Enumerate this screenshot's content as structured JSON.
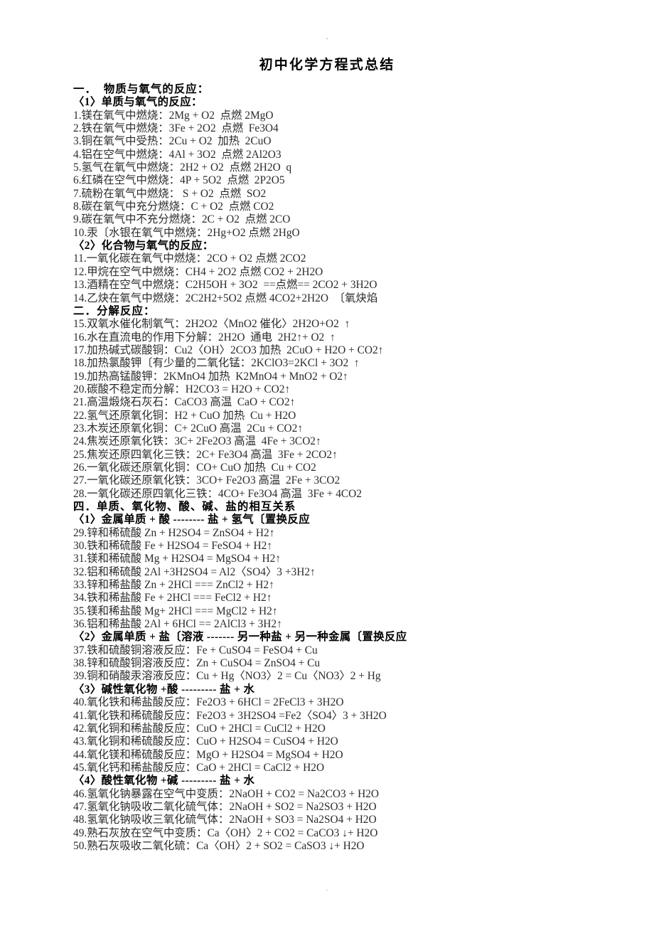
{
  "document": {
    "title": "初中化学方程式总结",
    "header_mark": "·",
    "footer_mark": "·"
  },
  "lines": [
    {
      "kind": "heading-major",
      "text": "一．  物质与氧气的反应："
    },
    {
      "kind": "heading",
      "text": "〈1〉单质与氧气的反应："
    },
    {
      "kind": "body",
      "text": "1.镁在氧气中燃烧：2Mg + O2  点燃 2MgO"
    },
    {
      "kind": "body",
      "text": "2.铁在氧气中燃烧：3Fe + 2O2  点燃  Fe3O4"
    },
    {
      "kind": "body",
      "text": "3.铜在氧气中受热：2Cu + O2  加热  2CuO"
    },
    {
      "kind": "body",
      "text": "4.铝在空气中燃烧：4Al + 3O2  点燃 2Al2O3"
    },
    {
      "kind": "body",
      "text": "5.氢气在氧气中燃烧：2H2 + O2  点燃 2H2O  q"
    },
    {
      "kind": "body",
      "text": "6.红磷在空气中燃烧：4P + 5O2  点燃  2P2O5"
    },
    {
      "kind": "body",
      "text": "7.硫粉在氧气中燃烧： S + O2  点燃  SO2"
    },
    {
      "kind": "body",
      "text": "8.碳在氧气中充分燃烧：C + O2  点燃 CO2"
    },
    {
      "kind": "body",
      "text": "9.碳在氧气中不充分燃烧：2C + O2  点燃 2CO"
    },
    {
      "kind": "body",
      "text": "10.汞〔水银在氧气中燃烧：2Hg+O2 点燃 2HgO"
    },
    {
      "kind": "heading",
      "text": "〈2〉化合物与氧气的反应："
    },
    {
      "kind": "body",
      "text": "11.一氧化碳在氧气中燃烧：2CO + O2 点燃 2CO2"
    },
    {
      "kind": "body",
      "text": "12.甲烷在空气中燃烧：CH4 + 2O2 点燃 CO2 + 2H2O"
    },
    {
      "kind": "body",
      "text": "13.酒精在空气中燃烧：C2H5OH + 3O2  ==点燃== 2CO2 + 3H2O"
    },
    {
      "kind": "body",
      "text": "14.乙炔在氧气中燃烧：2C2H2+5O2 点燃 4CO2+2H2O  〔氧炔焰"
    },
    {
      "kind": "heading-major",
      "text": "二．分解反应："
    },
    {
      "kind": "body",
      "text": "15.双氧水催化制氧气：2H2O2〈MnO2 催化〉2H2O+O2  ↑"
    },
    {
      "kind": "body",
      "text": "16.水在直流电的作用下分解：2H2O  通电  2H2↑+ O2  ↑"
    },
    {
      "kind": "body",
      "text": "17.加热碱式碳酸铜：Cu2〈OH〉2CO3 加热  2CuO + H2O + CO2↑"
    },
    {
      "kind": "body",
      "text": "18.加热氯酸钾〔有少量的二氧化锰：2KClO3=2KCl + 3O2  ↑"
    },
    {
      "kind": "body",
      "text": "19.加热高锰酸钾：2KMnO4 加热  K2MnO4 + MnO2 + O2↑"
    },
    {
      "kind": "body",
      "text": "20.碳酸不稳定而分解：H2CO3 = H2O + CO2↑"
    },
    {
      "kind": "body",
      "text": "21.高温煅烧石灰石：CaCO3 高温  CaO + CO2↑"
    },
    {
      "kind": "body",
      "text": "22.氢气还原氧化铜：H2 + CuO 加热  Cu + H2O"
    },
    {
      "kind": "body",
      "text": "23.木炭还原氧化铜：C+ 2CuO 高温  2Cu + CO2↑"
    },
    {
      "kind": "body",
      "text": "24.焦炭还原氧化铁：3C+ 2Fe2O3 高温  4Fe + 3CO2↑"
    },
    {
      "kind": "body",
      "text": "25.焦炭还原四氧化三铁：2C+ Fe3O4 高温  3Fe + 2CO2↑"
    },
    {
      "kind": "body",
      "text": "26.一氧化碳还原氧化铜：CO+ CuO 加热  Cu + CO2"
    },
    {
      "kind": "body",
      "text": "27.一氧化碳还原氧化铁：3CO+ Fe2O3 高温  2Fe + 3CO2"
    },
    {
      "kind": "body",
      "text": "28.一氧化碳还原四氧化三铁：4CO+ Fe3O4 高温  3Fe + 4CO2"
    },
    {
      "kind": "heading-major",
      "text": "四．单质、氧化物、酸、碱、盐的相互关系"
    },
    {
      "kind": "heading",
      "text": "〈1〉金属单质 + 酸 -------- 盐 + 氢气〔置换反应"
    },
    {
      "kind": "body",
      "text": "29.锌和稀硫酸 Zn + H2SO4 = ZnSO4 + H2↑"
    },
    {
      "kind": "body",
      "text": "30.铁和稀硫酸 Fe + H2SO4 = FeSO4 + H2↑"
    },
    {
      "kind": "body",
      "text": "31.镁和稀硫酸 Mg + H2SO4 = MgSO4 + H2↑"
    },
    {
      "kind": "body",
      "text": "32.铝和稀硫酸 2Al +3H2SO4 = Al2〈SO4〉3 +3H2↑"
    },
    {
      "kind": "body",
      "text": "33.锌和稀盐酸 Zn + 2HCl === ZnCl2 + H2↑"
    },
    {
      "kind": "body",
      "text": "34.铁和稀盐酸 Fe + 2HCl === FeCl2 + H2↑"
    },
    {
      "kind": "body",
      "text": "35.镁和稀盐酸 Mg+ 2HCl === MgCl2 + H2↑"
    },
    {
      "kind": "body",
      "text": "36.铝和稀盐酸 2Al + 6HCl == 2AlCl3 + 3H2↑"
    },
    {
      "kind": "heading",
      "text": "〈2〉金属单质 + 盐〔溶液 ------- 另一种盐 + 另一种金属〔置换反应"
    },
    {
      "kind": "body",
      "text": "37.铁和硫酸铜溶液反应：Fe + CuSO4 = FeSO4 + Cu"
    },
    {
      "kind": "body",
      "text": "38.锌和硫酸铜溶液反应：Zn + CuSO4 = ZnSO4 + Cu"
    },
    {
      "kind": "body",
      "text": "39.铜和硝酸汞溶液反应：Cu + Hg〈NO3〉2 = Cu〈NO3〉2 + Hg"
    },
    {
      "kind": "heading",
      "text": "〈3〉碱性氧化物 +酸 --------- 盐 + 水"
    },
    {
      "kind": "body",
      "text": "40.氧化铁和稀盐酸反应：Fe2O3 + 6HCl = 2FeCl3 + 3H2O"
    },
    {
      "kind": "body",
      "text": "41.氧化铁和稀硫酸反应：Fe2O3 + 3H2SO4 =Fe2〈SO4〉3 + 3H2O"
    },
    {
      "kind": "body",
      "text": "42.氧化铜和稀盐酸反应：CuO + 2HCl = CuCl2 + H2O"
    },
    {
      "kind": "body",
      "text": "43.氧化铜和稀硫酸反应：CuO + H2SO4 = CuSO4 + H2O"
    },
    {
      "kind": "body",
      "text": "44.氧化镁和稀硫酸反应：MgO + H2SO4 = MgSO4 + H2O"
    },
    {
      "kind": "body",
      "text": "45.氧化钙和稀盐酸反应：CaO + 2HCl = CaCl2 + H2O"
    },
    {
      "kind": "heading",
      "text": "〈4〉酸性氧化物 +碱 --------- 盐 + 水"
    },
    {
      "kind": "body",
      "text": "46.氢氧化钠暴露在空气中变质：2NaOH + CO2 = Na2CO3 + H2O"
    },
    {
      "kind": "body",
      "text": "47.氢氧化钠吸收二氧化硫气体：2NaOH + SO2 = Na2SO3 + H2O"
    },
    {
      "kind": "body",
      "text": "48.氢氧化钠吸收三氧化硫气体：2NaOH + SO3 = Na2SO4 + H2O"
    },
    {
      "kind": "body",
      "text": "49.熟石灰放在空气中变质：Ca〈OH〉2 + CO2 = CaCO3 ↓+ H2O"
    },
    {
      "kind": "body",
      "text": "50.熟石灰吸收二氧化硫：Ca〈OH〉2 + SO2 = CaSO3 ↓+ H2O"
    }
  ]
}
